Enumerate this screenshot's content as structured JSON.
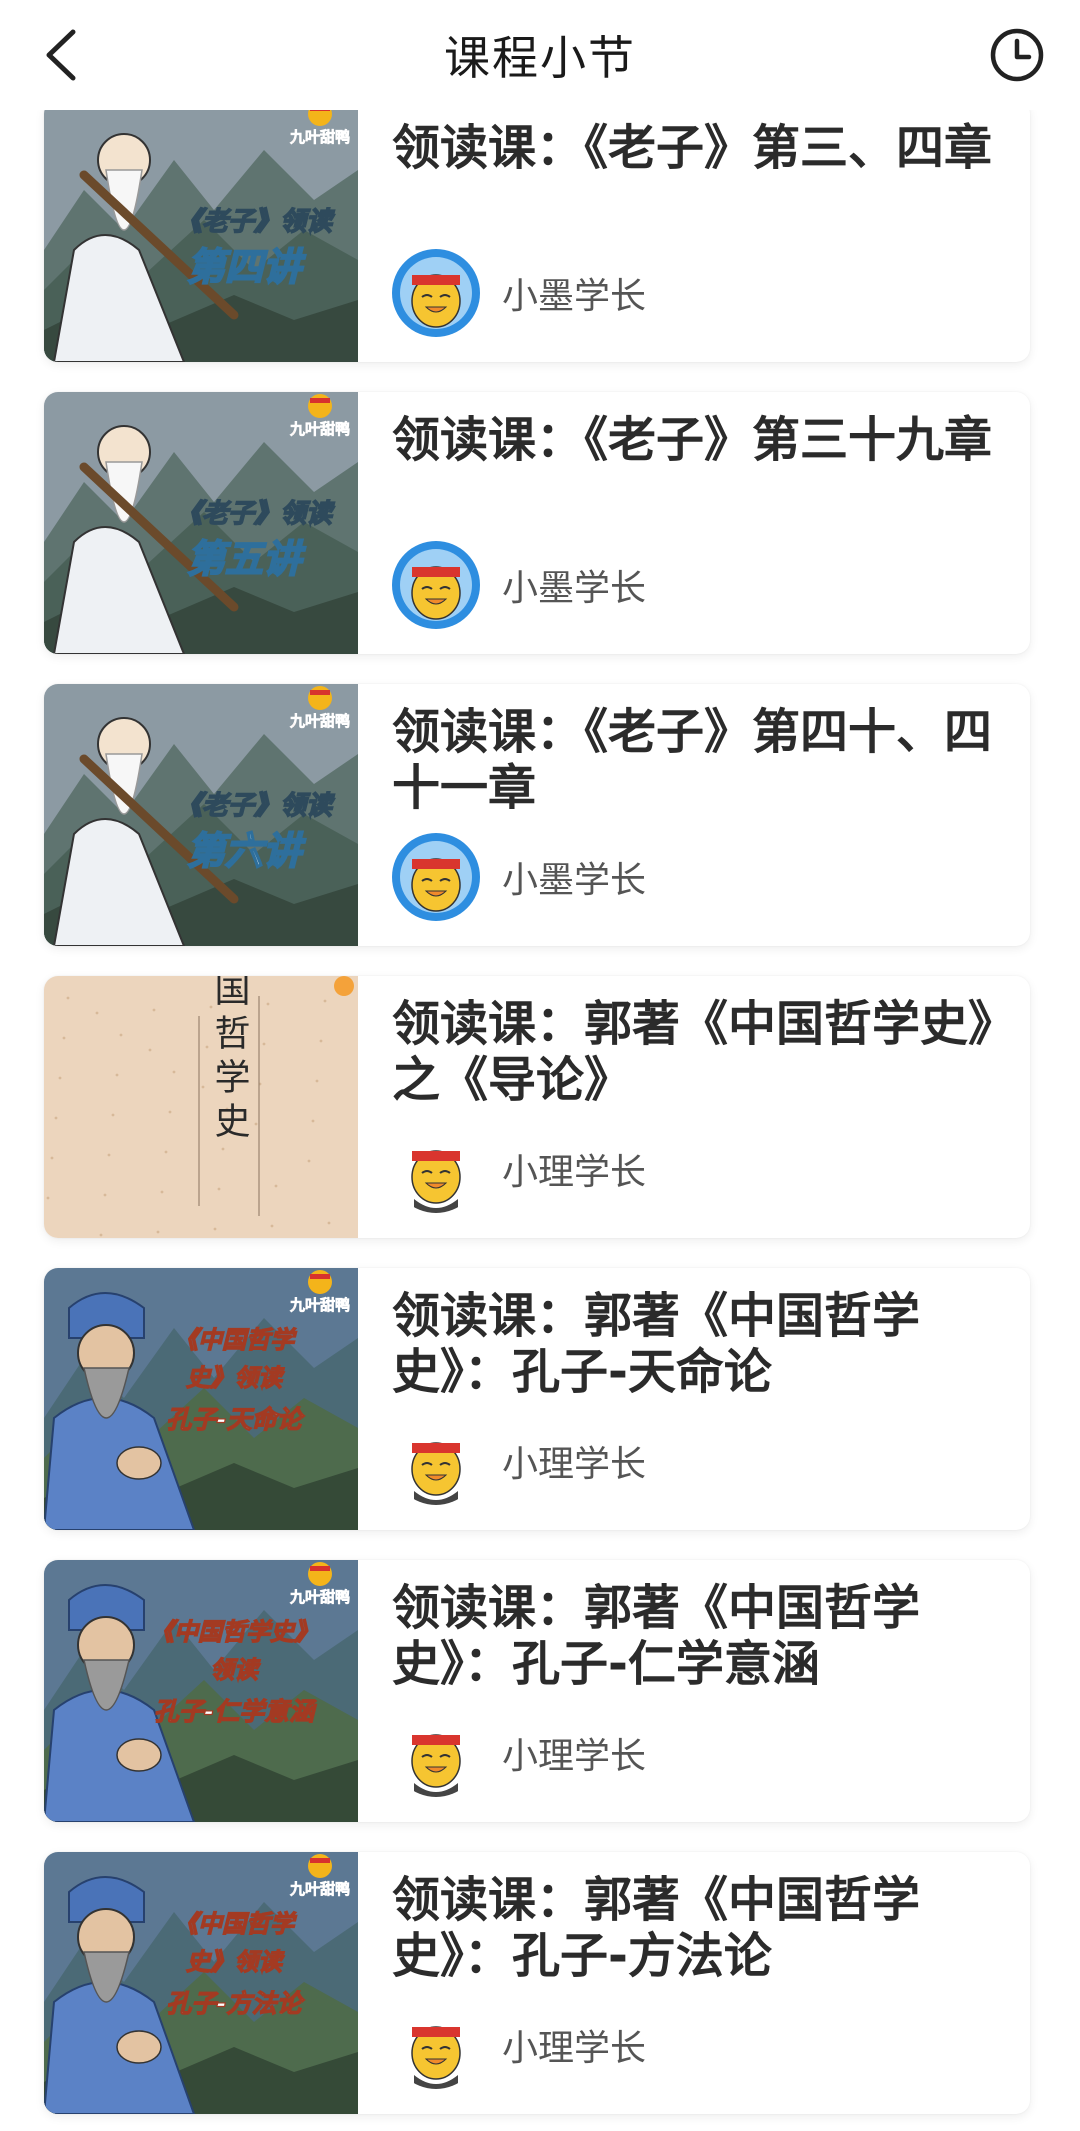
{
  "header": {
    "title": "课程小节",
    "back_icon": "chevron-left-icon",
    "history_icon": "clock-icon"
  },
  "lessons": [
    {
      "title": "领读课：《老子》第三、四章",
      "author": "小墨学长",
      "thumb_style": "laozi",
      "thumb_badge": "九叶甜鸭",
      "thumb_line1": "《老子》领读",
      "thumb_line2": "第四讲",
      "avatar_style": "blue"
    },
    {
      "title": "领读课：《老子》第三十九章",
      "author": "小墨学长",
      "thumb_style": "laozi",
      "thumb_badge": "九叶甜鸭",
      "thumb_line1": "《老子》领读",
      "thumb_line2": "第五讲",
      "avatar_style": "blue"
    },
    {
      "title": "领读课：《老子》第四十、四十一章",
      "author": "小墨学长",
      "thumb_style": "laozi",
      "thumb_badge": "九叶甜鸭",
      "thumb_line1": "《老子》领读",
      "thumb_line2": "第六讲",
      "avatar_style": "blue"
    },
    {
      "title": "领读课：郭著《中国哲学史》之《导论》",
      "author": "小理学长",
      "thumb_style": "book",
      "book_title": "中国哲学史",
      "avatar_style": "white"
    },
    {
      "title": "领读课：郭著《中国哲学史》：孔子-天命论",
      "author": "小理学长",
      "thumb_style": "confucius",
      "thumb_badge": "九叶甜鸭",
      "thumb_line1": "《中国哲学",
      "thumb_line2": "史》领读",
      "thumb_line3": "孔子-天命论",
      "avatar_style": "white"
    },
    {
      "title": "领读课：郭著《中国哲学史》：孔子-仁学意涵",
      "author": "小理学长",
      "thumb_style": "confucius",
      "thumb_badge": "九叶甜鸭",
      "thumb_line1": "《中国哲学史》",
      "thumb_line2": "领读",
      "thumb_line3": "孔子-仁学意涵",
      "avatar_style": "white"
    },
    {
      "title": "领读课：郭著《中国哲学史》：孔子-方法论",
      "author": "小理学长",
      "thumb_style": "confucius",
      "thumb_badge": "九叶甜鸭",
      "thumb_line1": "《中国哲学",
      "thumb_line2": "史》领读",
      "thumb_line3": "孔子-方法论",
      "avatar_style": "white"
    }
  ]
}
